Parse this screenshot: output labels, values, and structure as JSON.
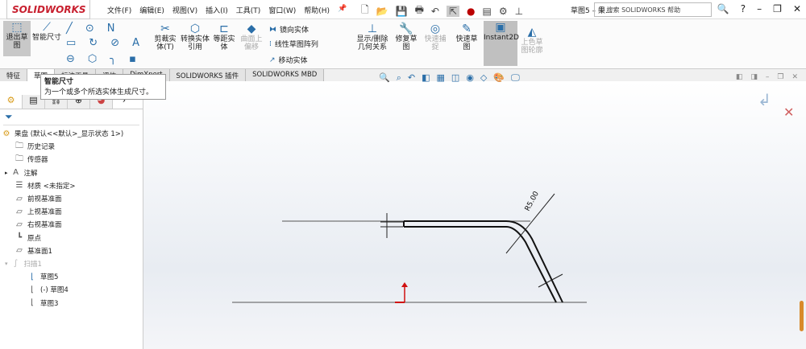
{
  "app": {
    "logo": "SOLIDWORKS",
    "doc_title": "草图5 – 果...",
    "search_placeholder": "搜索 SOLIDWORKS 帮助",
    "minimize": "–",
    "restore": "❐",
    "close": "✕",
    "help": "?"
  },
  "menu": [
    "文件(F)",
    "编辑(E)",
    "视图(V)",
    "插入(I)",
    "工具(T)",
    "窗口(W)",
    "帮助(H)"
  ],
  "ribbon": {
    "exit_sketch": "退出草图",
    "smart_dim": "智能尺寸",
    "trim": "剪裁实体(T)",
    "convert": "转换实体引用",
    "offset": "等距实体",
    "surface_offset": "曲面上偏移",
    "mirror": "镜向实体",
    "linear_pattern": "线性草图阵列",
    "move": "移动实体",
    "show_relations": "显示/删除几何关系",
    "repair": "修复草图",
    "quick_snap": "快速捕捉",
    "rapid_sketch": "快速草图",
    "instant2d": "Instant2D",
    "shaded_contours": "上色草图轮廓"
  },
  "tabs": [
    "特征",
    "草图",
    "标注工具",
    "评估",
    "DimXpert",
    "SOLIDWORKS 插件",
    "SOLIDWORKS MBD"
  ],
  "tooltip": {
    "title": "智能尺寸",
    "desc": "为一个或多个所选实体生成尺寸。"
  },
  "tree": {
    "root": "果盘 (默认<<默认>_显示状态 1>)",
    "items": [
      "历史记录",
      "传感器",
      "注解",
      "材质 <未指定>",
      "前视基准面",
      "上视基准面",
      "右视基准面",
      "原点",
      "基准面1",
      "扫描1",
      "草图5",
      "(-) 草图4",
      "草图3"
    ]
  },
  "sketch": {
    "dimension": "R5.00",
    "origin_color": "#d01010"
  }
}
